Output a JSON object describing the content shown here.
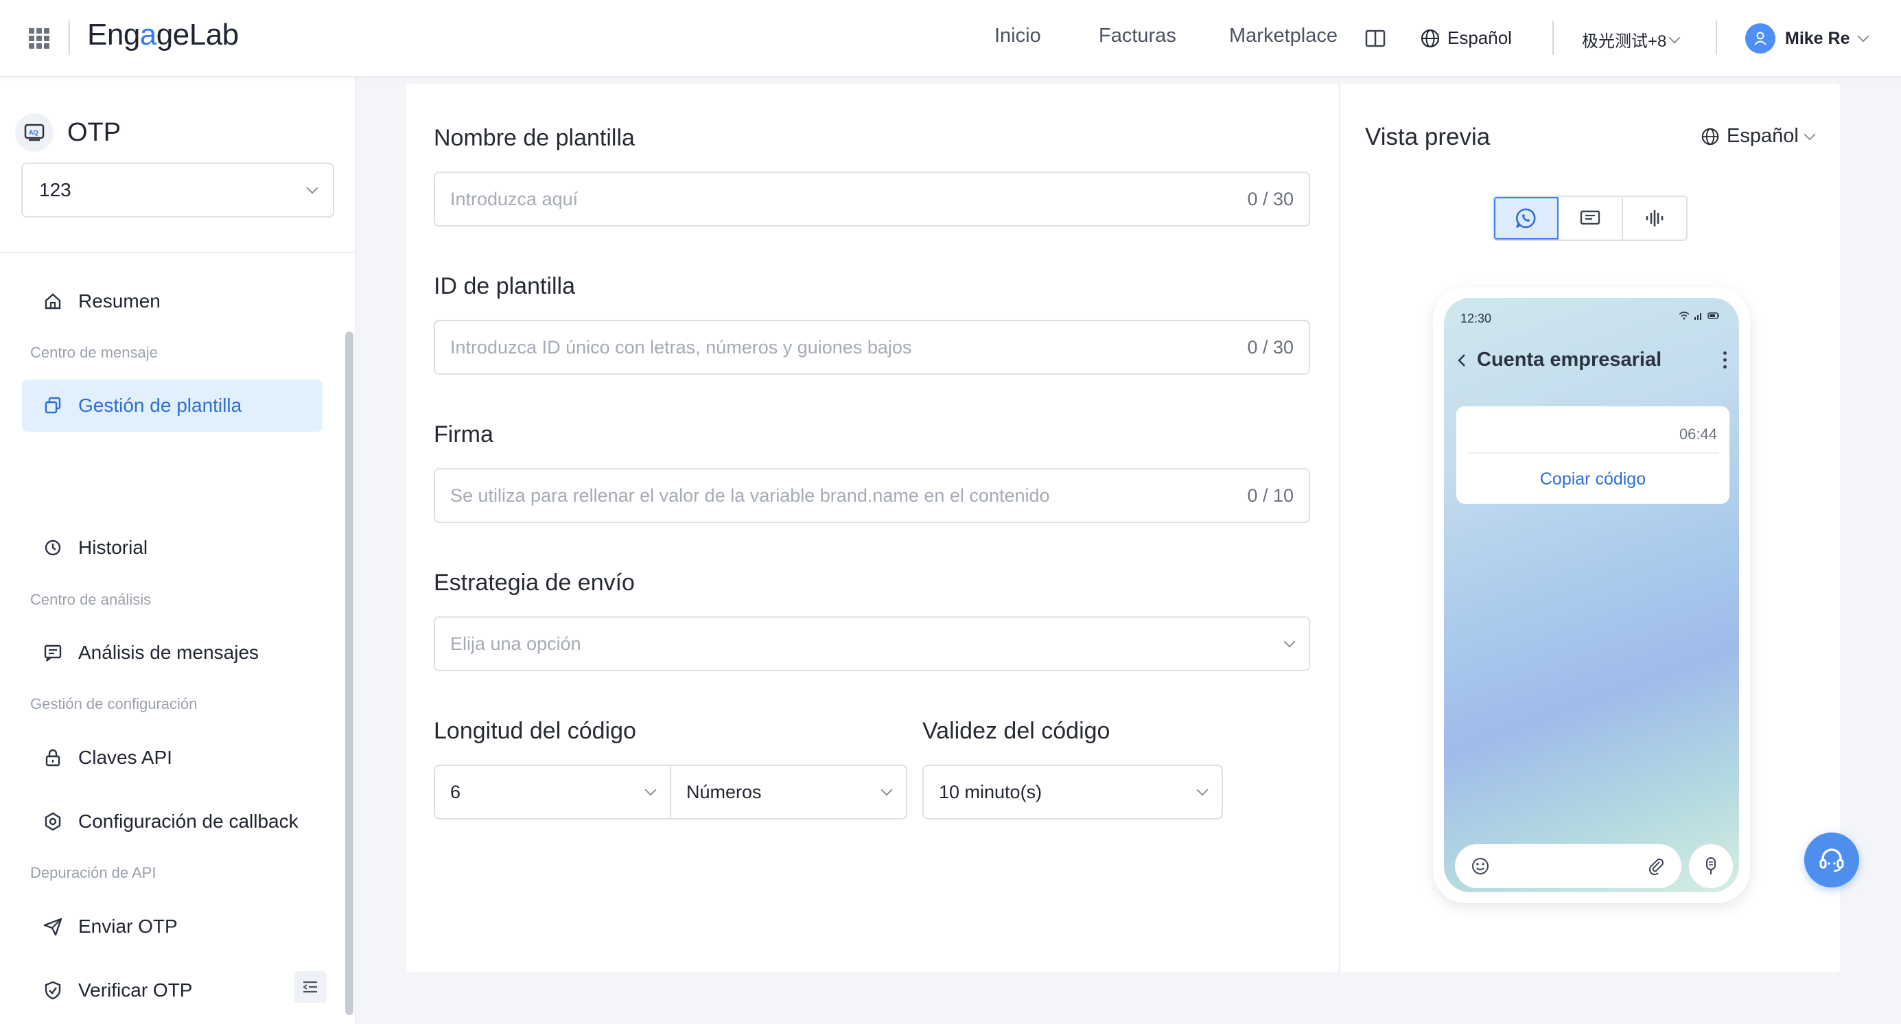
{
  "header": {
    "brand": {
      "part1": "Eng",
      "part2": "a",
      "part3": "geLab"
    },
    "nav": {
      "inicio": "Inicio",
      "facturas": "Facturas",
      "marketplace": "Marketplace"
    },
    "language": "Español",
    "account": "极光测试+8",
    "user": "Mike Re"
  },
  "sidebar": {
    "product": "OTP",
    "app_select": "123",
    "items": {
      "resumen": "Resumen",
      "group_mensaje": "Centro de mensaje",
      "gestion": "Gestión de plantilla",
      "historial": "Historial",
      "group_analisis": "Centro de análisis",
      "analisis": "Análisis de mensajes",
      "group_config": "Gestión de configuración",
      "claves": "Claves API",
      "callback": "Configuración de callback",
      "group_api": "Depuración de API",
      "enviar": "Enviar OTP",
      "verificar": "Verificar OTP"
    }
  },
  "form": {
    "nombre": {
      "label": "Nombre de plantilla",
      "placeholder": "Introduzca aquí",
      "count": "0 / 30"
    },
    "id": {
      "label": "ID de plantilla",
      "placeholder": "Introduzca ID único con letras, números y guiones bajos",
      "count": "0 / 30"
    },
    "firma": {
      "label": "Firma",
      "placeholder": "Se utiliza para rellenar el valor de la variable brand.name en el contenido",
      "count": "0 / 10"
    },
    "estrategia": {
      "label": "Estrategia de envío",
      "placeholder": "Elija una opción"
    },
    "longitud": {
      "label": "Longitud del código",
      "value": "6",
      "type": "Números"
    },
    "validez": {
      "label": "Validez del código",
      "value": "10 minuto(s)"
    }
  },
  "preview": {
    "title": "Vista previa",
    "language": "Español",
    "phone": {
      "time": "12:30",
      "chat_title": "Cuenta empresarial",
      "bubble_time": "06:44",
      "copy_code": "Copiar código"
    }
  },
  "colors": {
    "accent": "#2e7df6",
    "active_bg": "#e2effd",
    "page_bg": "#f3f5f8"
  }
}
